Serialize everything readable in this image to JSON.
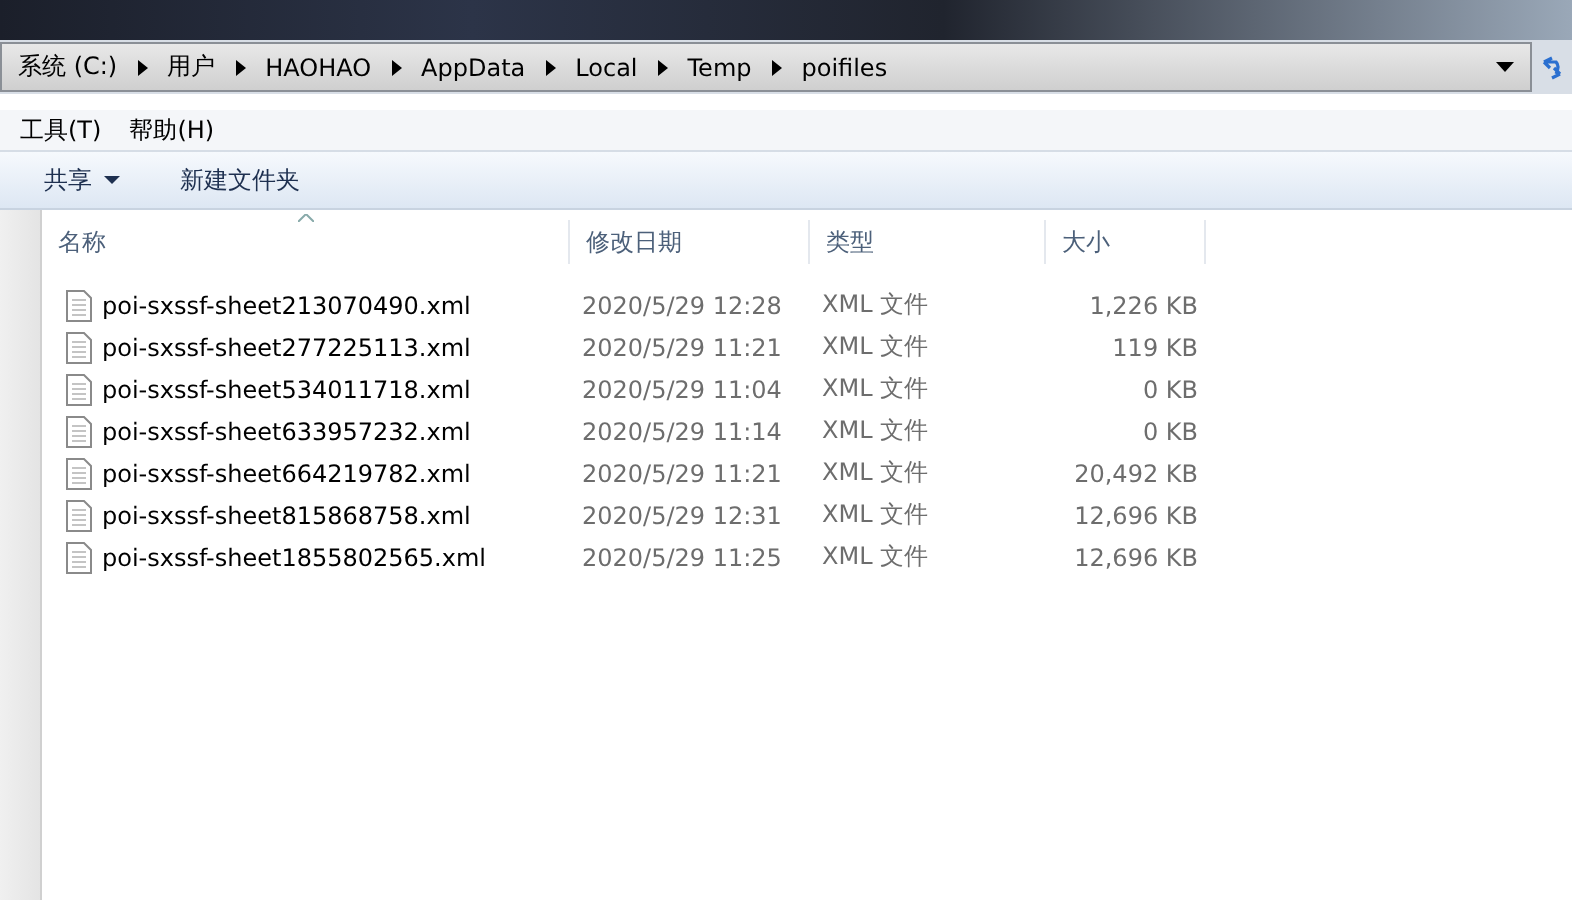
{
  "address_bar": {
    "segments": [
      "系统 (C:)",
      "用户",
      "HAOHAO",
      "AppData",
      "Local",
      "Temp",
      "poifiles"
    ]
  },
  "menu": [
    "工具(T)",
    "帮助(H)"
  ],
  "toolbar": [
    {
      "label": "共享",
      "dropdown": true
    },
    {
      "label": "新建文件夹",
      "dropdown": false
    }
  ],
  "table": {
    "columns": [
      "名称",
      "修改日期",
      "类型",
      "大小"
    ],
    "rows": [
      {
        "name": "poi-sxssf-sheet213070490.xml",
        "date": "2020/5/29 12:28",
        "type": "XML 文件",
        "size": "1,226 KB"
      },
      {
        "name": "poi-sxssf-sheet277225113.xml",
        "date": "2020/5/29 11:21",
        "type": "XML 文件",
        "size": "119 KB"
      },
      {
        "name": "poi-sxssf-sheet534011718.xml",
        "date": "2020/5/29 11:04",
        "type": "XML 文件",
        "size": "0 KB"
      },
      {
        "name": "poi-sxssf-sheet633957232.xml",
        "date": "2020/5/29 11:14",
        "type": "XML 文件",
        "size": "0 KB"
      },
      {
        "name": "poi-sxssf-sheet664219782.xml",
        "date": "2020/5/29 11:21",
        "type": "XML 文件",
        "size": "20,492 KB"
      },
      {
        "name": "poi-sxssf-sheet815868758.xml",
        "date": "2020/5/29 12:31",
        "type": "XML 文件",
        "size": "12,696 KB"
      },
      {
        "name": "poi-sxssf-sheet1855802565.xml",
        "date": "2020/5/29 11:25",
        "type": "XML 文件",
        "size": "12,696 KB"
      }
    ]
  }
}
